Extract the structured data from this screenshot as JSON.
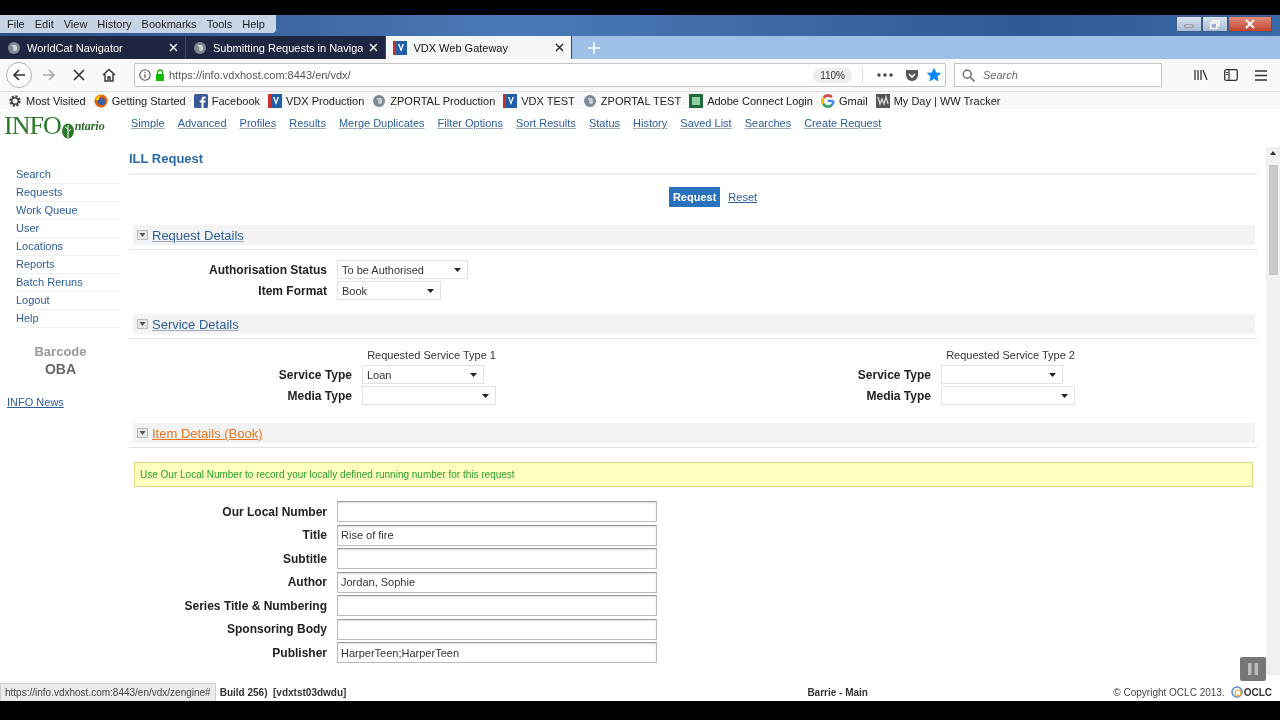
{
  "menu": [
    "File",
    "Edit",
    "View",
    "History",
    "Bookmarks",
    "Tools",
    "Help"
  ],
  "tabs": [
    {
      "label": "WorldCat Navigator",
      "kind": "globe",
      "selected": false
    },
    {
      "label": "Submitting Requests in Naviga",
      "kind": "globe",
      "selected": false
    },
    {
      "label": "VDX Web Gateway",
      "kind": "vdx",
      "selected": true
    }
  ],
  "address_bar": {
    "url": "https://info.vdxhost.com:8443/en/vdx/",
    "zoom": "110%",
    "bookmarked": true
  },
  "search": {
    "placeholder": "Search"
  },
  "bookmarks": [
    {
      "label": "Most Visited",
      "kind": "gear"
    },
    {
      "label": "Getting Started",
      "kind": "firefox"
    },
    {
      "label": "Facebook",
      "kind": "facebook"
    },
    {
      "label": "VDX Production",
      "kind": "vdx"
    },
    {
      "label": "ZPORTAL Production",
      "kind": "globe"
    },
    {
      "label": "VDX TEST",
      "kind": "vdx"
    },
    {
      "label": "ZPORTAL TEST",
      "kind": "globe"
    },
    {
      "label": "Adobe Connect Login",
      "kind": "adobe"
    },
    {
      "label": "Gmail",
      "kind": "google"
    },
    {
      "label": "My Day | WW Tracker",
      "kind": "tracker"
    }
  ],
  "logo": {
    "main": "INFO",
    "tail": "ntario"
  },
  "top_links": [
    "Simple",
    "Advanced",
    "Profiles",
    "Results",
    "Merge Duplicates",
    "Filter Options",
    "Sort Results",
    "Status",
    "History",
    "Saved List",
    "Searches",
    "Create Request"
  ],
  "sidebar": {
    "items": [
      "Search",
      "Requests",
      "Work Queue",
      "User",
      "Locations",
      "Reports",
      "Batch Reruns",
      "Logout",
      "Help"
    ],
    "barcode_label": "Barcode",
    "barcode_value": "OBA",
    "news_link": "INFO News"
  },
  "page_title": "ILL Request",
  "actions": [
    {
      "label": "Request",
      "kind": "primary"
    },
    {
      "label": "Reset",
      "kind": "link"
    }
  ],
  "sections": [
    {
      "title": "Request Details",
      "kind": "fields",
      "selected": false,
      "fields": [
        {
          "label": "Authorisation Status",
          "kind": "select",
          "value": "To be Authorised"
        },
        {
          "label": "Item Format",
          "kind": "select",
          "value": "Book"
        }
      ]
    },
    {
      "title": "Service Details",
      "kind": "columns",
      "selected": false,
      "columns": [
        {
          "heading": "Requested Service Type 1",
          "fields": [
            {
              "label": "Service Type",
              "kind": "select",
              "value": "Loan"
            },
            {
              "label": "Media Type",
              "kind": "select"
            }
          ]
        },
        {
          "heading": "Requested Service Type 2",
          "fields": [
            {
              "label": "Service Type",
              "kind": "select"
            },
            {
              "label": "Media Type",
              "kind": "select"
            }
          ]
        }
      ]
    },
    {
      "title": "Item Details (Book)",
      "kind": "fields",
      "selected": true,
      "hint": "Use Our Local Number to record your locally defined running number for this request",
      "fields": [
        {
          "label": "Our Local Number",
          "kind": "text"
        },
        {
          "label": "Title",
          "kind": "text",
          "value": "Rise of fire"
        },
        {
          "label": "Subtitle",
          "kind": "text"
        },
        {
          "label": "Author",
          "kind": "text",
          "value": "Jordan, Sophie"
        },
        {
          "label": "Series Title & Numbering",
          "kind": "text"
        },
        {
          "label": "Sponsoring Body",
          "kind": "text"
        },
        {
          "label": "Publisher",
          "kind": "text",
          "value": "HarperTeen;HarperTeen"
        }
      ]
    }
  ],
  "status_url": "https://info.vdxhost.com:8443/en/vdx/zengine#",
  "footer": {
    "build": "Build 256)  [vdxtst03dwdu]",
    "location": "Barrie - Main",
    "copyright": "© Copyright OCLC 2013.",
    "brand": "OCLC"
  }
}
